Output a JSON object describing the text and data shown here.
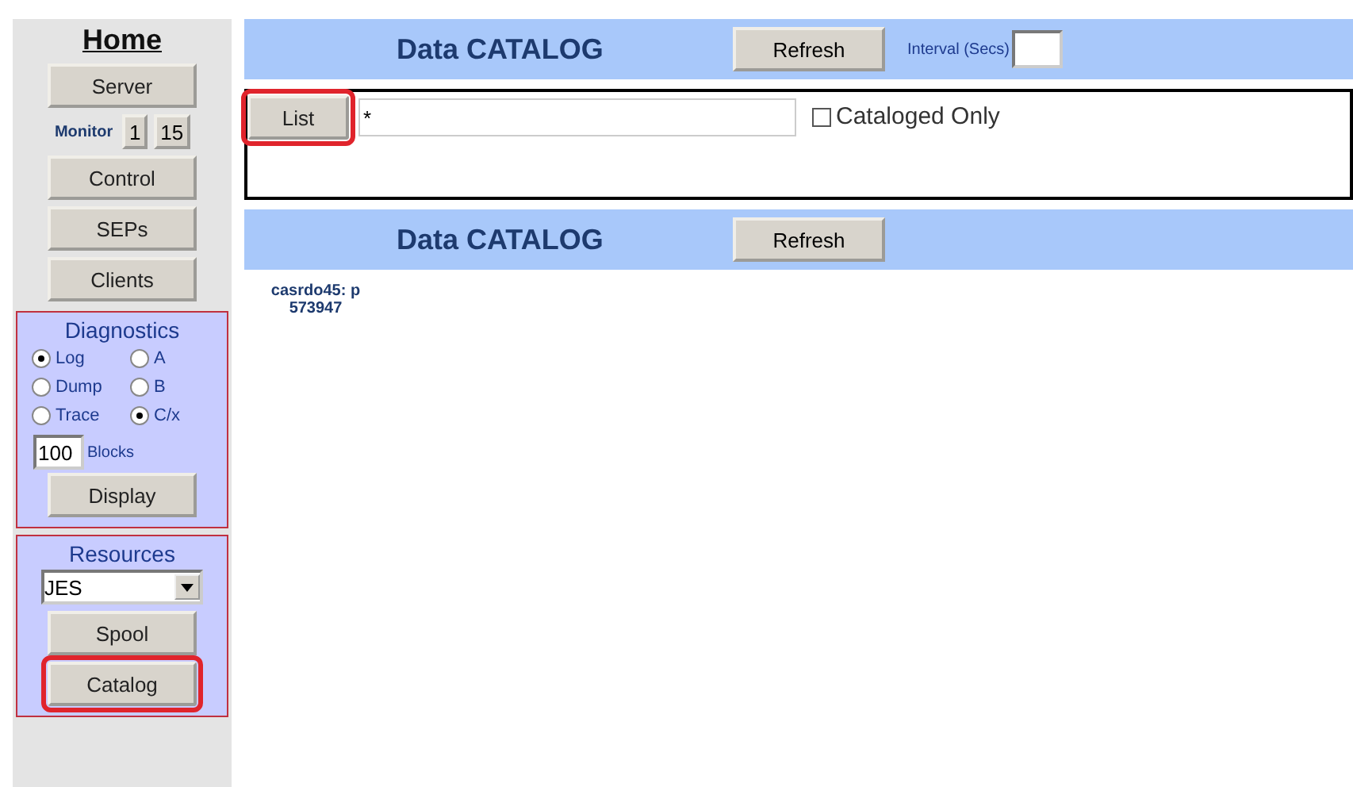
{
  "sidebar": {
    "title": "Home",
    "server_button": {
      "label": "Server"
    },
    "monitor": {
      "label": "Monitor",
      "buttons": [
        "1",
        "15"
      ]
    },
    "buttons": [
      {
        "label": "Control"
      },
      {
        "label": "SEPs"
      },
      {
        "label": "Clients"
      }
    ],
    "diagnostics": {
      "title": "Diagnostics",
      "options": [
        {
          "label": "Log",
          "selected": true
        },
        {
          "label": "A",
          "selected": false
        },
        {
          "label": "Dump",
          "selected": false
        },
        {
          "label": "B",
          "selected": false
        },
        {
          "label": "Trace",
          "selected": false
        },
        {
          "label": "C/x",
          "selected": true
        }
      ],
      "blocks": {
        "value": "100",
        "label": "Blocks"
      },
      "display_button": "Display"
    },
    "resources": {
      "title": "Resources",
      "select": "JES",
      "buttons": [
        {
          "label": "Spool",
          "annotated": false
        },
        {
          "label": "Catalog",
          "annotated": true
        }
      ]
    }
  },
  "main": {
    "header": {
      "title": "Data CATALOG",
      "refresh": "Refresh",
      "interval_label": "Interval (Secs)"
    },
    "filter": {
      "list_button": {
        "label": "List",
        "annotated": true
      },
      "value": "*",
      "cataloged_only": {
        "label": "Cataloged Only",
        "checked": false
      }
    },
    "results_header": {
      "title": "Data CATALOG",
      "refresh": "Refresh"
    },
    "results": [
      {
        "line1": "casrdo45: p",
        "line2": "573947"
      }
    ]
  }
}
